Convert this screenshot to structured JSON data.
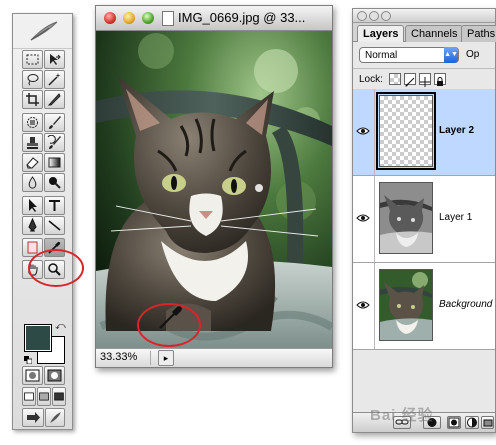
{
  "document": {
    "title": "IMG_0669.jpg @ 33...",
    "zoom": "33.33%",
    "status_button": "▸"
  },
  "toolbox": {
    "foreground_color": "#2e4a47",
    "background_color": "#ffffff",
    "tools": [
      "marquee-icon",
      "move-icon",
      "lasso-icon",
      "magic-wand-icon",
      "crop-icon",
      "slice-icon",
      "healing-brush-icon",
      "brush-icon",
      "clone-stamp-icon",
      "history-brush-icon",
      "eraser-icon",
      "gradient-icon",
      "blur-icon",
      "dodge-icon",
      "path-selection-icon",
      "type-icon",
      "pen-icon",
      "line-icon",
      "notes-icon",
      "eyedropper-icon",
      "hand-icon",
      "zoom-icon"
    ]
  },
  "layers_palette": {
    "tabs": [
      {
        "label": "Layers"
      },
      {
        "label": "Channels"
      },
      {
        "label": "Paths"
      }
    ],
    "blend_mode": "Normal",
    "opacity_label": "Op",
    "lock_label": "Lock:",
    "layers": [
      {
        "name": "Layer 2",
        "selected": true
      },
      {
        "name": "Layer 1",
        "selected": false
      },
      {
        "name": "Background",
        "selected": false
      }
    ]
  },
  "watermark": "Bai 经验",
  "colors": {
    "annotation_red": "#d7252a",
    "selection_blue": "#bed8ff"
  }
}
